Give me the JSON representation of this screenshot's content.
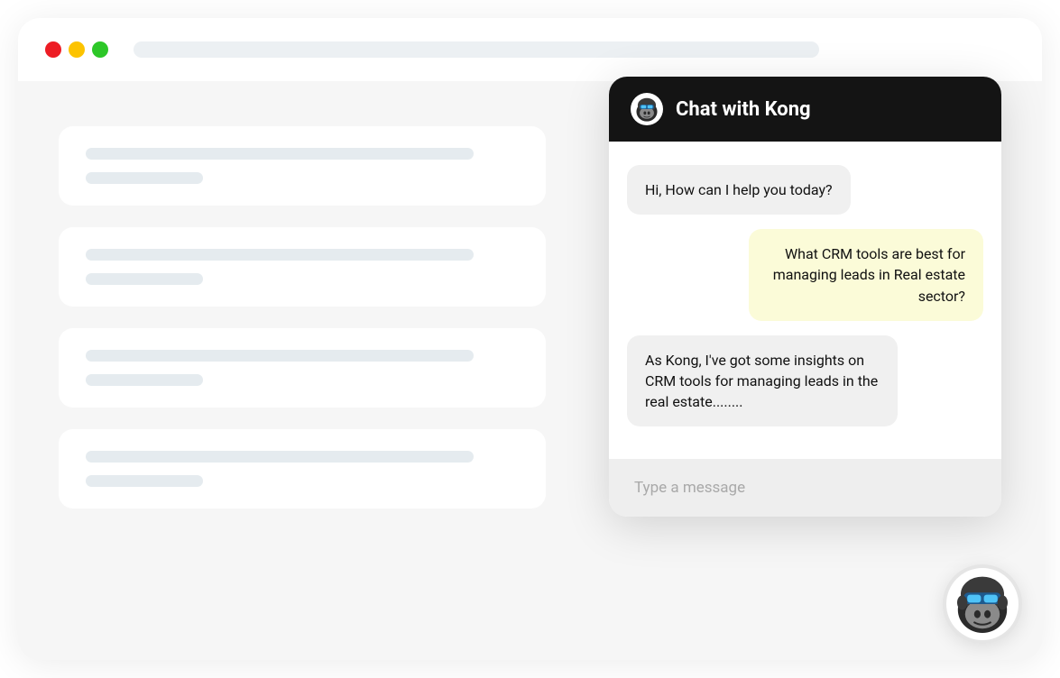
{
  "chat": {
    "header_title": "Chat with Kong",
    "messages": [
      {
        "role": "bot",
        "text": "Hi, How can I help you today?"
      },
      {
        "role": "user",
        "text": "What CRM tools are best for managing leads in Real estate sector?"
      },
      {
        "role": "bot",
        "text": "As Kong, I've got some insights on CRM tools for managing leads in the real estate........"
      }
    ],
    "input_placeholder": "Type a message"
  },
  "colors": {
    "traffic_red": "#ed1c24",
    "traffic_yellow": "#fcc300",
    "traffic_green": "#2dc728",
    "chat_header_bg": "#141414",
    "bot_bubble": "#f0f0f0",
    "user_bubble": "#fbfbd8"
  },
  "icons": {
    "avatar": "gorilla-avatar-icon"
  }
}
